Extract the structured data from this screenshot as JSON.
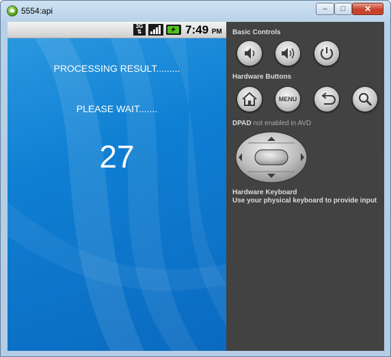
{
  "window": {
    "title": "5554:api",
    "minimize_label": "–",
    "maximize_label": "□",
    "close_label": "✕"
  },
  "status_bar": {
    "network_label": "3G",
    "time": "7:49",
    "ampm": "PM",
    "icons": [
      "3g-data-icon",
      "signal-strength-icon",
      "battery-charging-icon"
    ]
  },
  "screen": {
    "line1": "PROCESSING RESULT.........",
    "line2": "PLEASE WAIT.......",
    "counter": "27"
  },
  "controls": {
    "basic_title": "Basic Controls",
    "basic_buttons": [
      "volume-down-icon",
      "volume-up-icon",
      "power-icon"
    ],
    "hardware_title": "Hardware Buttons",
    "hardware_buttons": [
      "home-icon",
      "menu",
      "back-icon",
      "search-icon"
    ],
    "menu_label": "MENU",
    "dpad_title": "DPAD",
    "dpad_note": "not enabled in AVD",
    "keyboard_title": "Hardware Keyboard",
    "keyboard_hint": "Use your physical keyboard to provide input"
  }
}
